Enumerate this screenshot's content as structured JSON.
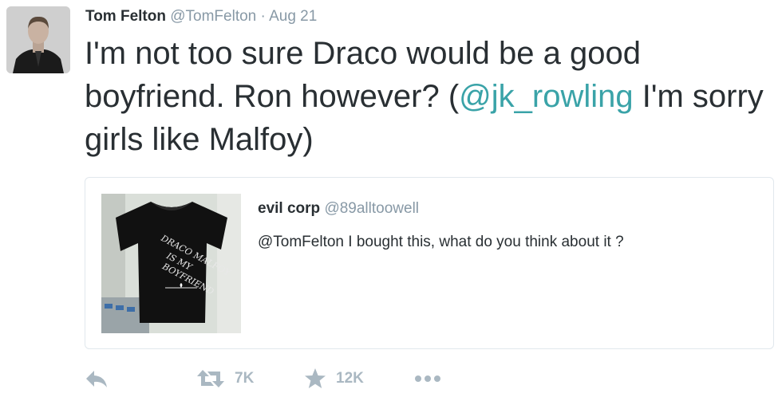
{
  "tweet": {
    "author_name": "Tom Felton",
    "author_handle": "@TomFelton",
    "separator": "·",
    "timestamp": "Aug 21",
    "text_part1": "I'm not too sure Draco would be a good boyfriend. Ron however? (",
    "mention": "@jk_rowling",
    "text_part2": " I'm sorry girls like Malfoy)",
    "mention_color": "#3aa3a8"
  },
  "quoted_tweet": {
    "author_name": "evil corp",
    "author_handle": "@89alltoowell",
    "text": "@TomFelton I bought this, what do you think about it ?",
    "image_icon": "tshirt-photo",
    "shirt_text": [
      "DRACO MALFOY",
      "IS MY",
      "BOYFRIEND"
    ]
  },
  "actions": {
    "reply_icon": "reply-icon",
    "retweet_icon": "retweet-icon",
    "retweet_count": "7K",
    "favorite_icon": "star-icon",
    "favorite_count": "12K",
    "more_icon": "more-icon"
  },
  "colors": {
    "text": "#292f33",
    "muted": "#8899a6",
    "action_gray": "#aab8c2",
    "border": "#e1e8ed"
  }
}
